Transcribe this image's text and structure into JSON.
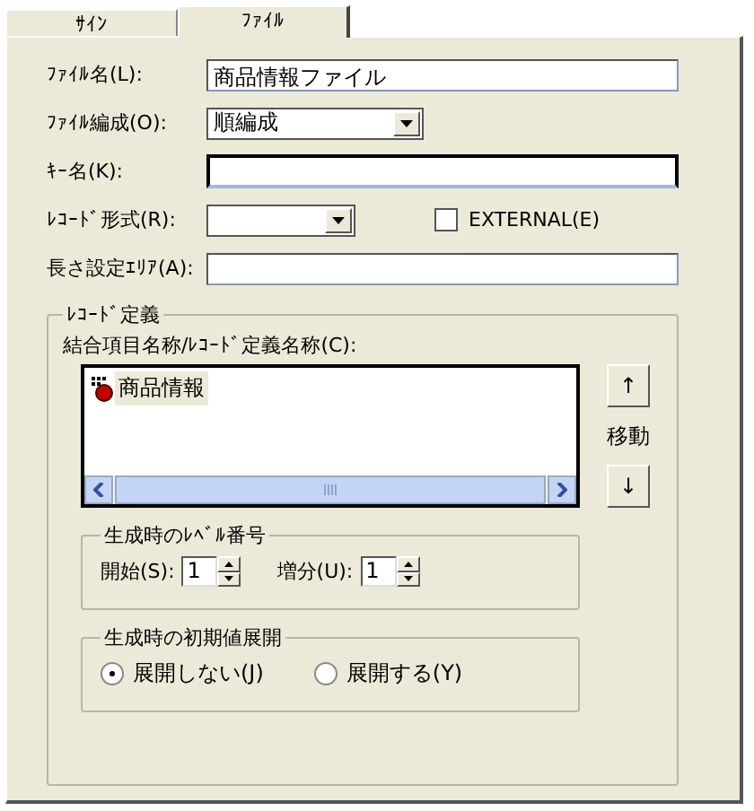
{
  "tabs": [
    {
      "label": "ｻｲﾝ",
      "selected": false
    },
    {
      "label": "ﾌｧｲﾙ",
      "selected": true
    }
  ],
  "fields": [
    {
      "kind": "text",
      "label": "ﾌｧｲﾙ名(L):",
      "value": "商品情報ファイル",
      "focused": false
    },
    {
      "kind": "select",
      "label": "ﾌｧｲﾙ編成(O):",
      "value": "順編成"
    },
    {
      "kind": "text",
      "label": "ｷｰ名(K):",
      "focused": true
    },
    {
      "kind": "select",
      "label": "ﾚｺｰﾄﾞ形式(R):",
      "checkbox": {
        "label": "EXTERNAL(E)",
        "checked": false
      }
    },
    {
      "kind": "text",
      "label": "長さ設定ｴﾘｱ(A):",
      "focused": false
    }
  ],
  "record_definition": {
    "title": "ﾚｺｰﾄﾞ定義",
    "list_label": "結合項目名称/ﾚｺｰﾄﾞ定義名称(C):",
    "items": [
      {
        "label": "商品情報",
        "selected": true
      }
    ],
    "move_up": "↑",
    "move_label": "移動",
    "move_down": "↓",
    "level": {
      "title": "生成時のﾚﾍﾞﾙ番号",
      "spinners": [
        {
          "label": "開始(S):",
          "value": "1"
        },
        {
          "label": "増分(U):",
          "value": "1"
        }
      ]
    },
    "expand": {
      "title": "生成時の初期値展開",
      "options": [
        {
          "label": "展開しない(J)",
          "selected": true
        },
        {
          "label": "展開する(Y)",
          "selected": false
        }
      ]
    }
  }
}
